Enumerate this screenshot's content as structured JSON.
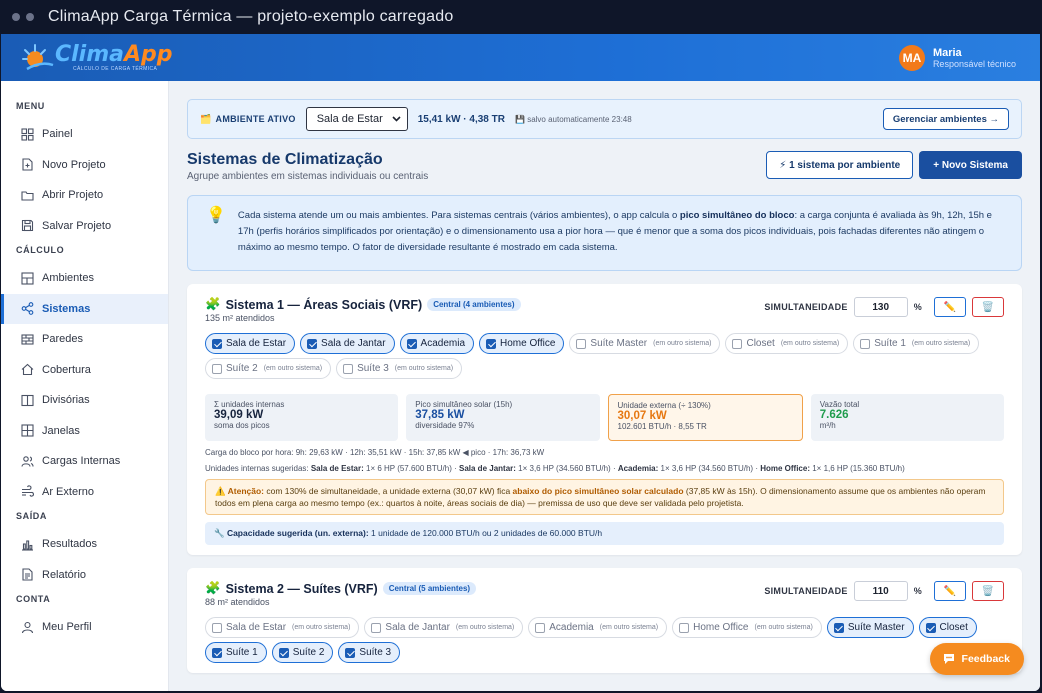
{
  "window": {
    "title": "ClimaApp Carga Térmica — projeto-exemplo carregado"
  },
  "brand": {
    "name_a": "Clima",
    "name_b": "App",
    "tagline": "CÁLCULO DE CARGA TÉRMICA",
    "colors": {
      "blue": "#1e6fd6",
      "orange": "#f58b1f"
    }
  },
  "user": {
    "initials": "MA",
    "name": "Maria",
    "role": "Responsável técnico"
  },
  "sidebar": {
    "sections": [
      {
        "label": "MENU",
        "items": [
          {
            "label": "Painel",
            "icon": "grid-icon"
          },
          {
            "label": "Novo Projeto",
            "icon": "file-plus-icon"
          },
          {
            "label": "Abrir Projeto",
            "icon": "folder-icon"
          },
          {
            "label": "Salvar Projeto",
            "icon": "save-icon"
          }
        ]
      },
      {
        "label": "CÁLCULO",
        "items": [
          {
            "label": "Ambientes",
            "icon": "layout-icon"
          },
          {
            "label": "Sistemas",
            "icon": "share-icon",
            "active": true
          },
          {
            "label": "Paredes",
            "icon": "brick-icon"
          },
          {
            "label": "Cobertura",
            "icon": "home-icon"
          },
          {
            "label": "Divisórias",
            "icon": "columns-icon"
          },
          {
            "label": "Janelas",
            "icon": "window-icon"
          },
          {
            "label": "Cargas Internas",
            "icon": "users-icon"
          },
          {
            "label": "Ar Externo",
            "icon": "wind-icon"
          }
        ]
      },
      {
        "label": "SAÍDA",
        "items": [
          {
            "label": "Resultados",
            "icon": "bar-chart-icon"
          },
          {
            "label": "Relatório",
            "icon": "document-icon"
          }
        ]
      },
      {
        "label": "CONTA",
        "items": [
          {
            "label": "Meu Perfil",
            "icon": "user-icon"
          }
        ]
      }
    ]
  },
  "active_env": {
    "label": "AMBIENTE ATIVO",
    "selected": "Sala de Estar",
    "value": "15,41 kW · 4,38 TR",
    "saved": "salvo automaticamente 23:48",
    "manage_button": "Gerenciar ambientes →"
  },
  "page": {
    "title": "Sistemas de Climatização",
    "subtitle": "Agrupe ambientes em sistemas individuais ou centrais",
    "btn_one_per_env": "⚡ 1 sistema por ambiente",
    "btn_new": "+ Novo Sistema"
  },
  "info": {
    "t1": "Cada sistema atende um ou mais ambientes. Para sistemas centrais (vários ambientes), o app calcula o ",
    "b1": "pico simultâneo do bloco",
    "t2": ": a carga conjunta é avaliada às 9h, 12h, 15h e 17h (perfis horários simplificados por orientação) e o dimensionamento usa a pior hora — que é menor que a soma dos picos individuais, pois fachadas diferentes não atingem o máximo ao mesmo tempo. O fator de diversidade resultante é mostrado em cada sistema."
  },
  "simul_label": "SIMULTANEIDADE",
  "pct": "%",
  "systems": [
    {
      "title": "Sistema 1 — Áreas Sociais (VRF)",
      "pill": "Central (4 ambientes)",
      "area": "135 m² atendidos",
      "simul": "130",
      "chips": [
        {
          "label": "Sala de Estar",
          "on": true,
          "note": ""
        },
        {
          "label": "Sala de Jantar",
          "on": true,
          "note": ""
        },
        {
          "label": "Academia",
          "on": true,
          "note": ""
        },
        {
          "label": "Home Office",
          "on": true,
          "note": ""
        },
        {
          "label": "Suíte Master",
          "on": false,
          "note": "(em outro sistema)"
        },
        {
          "label": "Closet",
          "on": false,
          "note": "(em outro sistema)"
        },
        {
          "label": "Suíte 1",
          "on": false,
          "note": "(em outro sistema)"
        },
        {
          "label": "Suíte 2",
          "on": false,
          "note": "(em outro sistema)"
        },
        {
          "label": "Suíte 3",
          "on": false,
          "note": "(em outro sistema)"
        }
      ],
      "stats": [
        {
          "label": "Σ unidades internas",
          "value": "39,09 kW",
          "sub": "soma dos picos",
          "style": ""
        },
        {
          "label": "Pico simultâneo solar (15h)",
          "value": "37,85 kW",
          "sub": "diversidade 97%",
          "style": "blue"
        },
        {
          "label": "Unidade externa (÷ 130%)",
          "value": "30,07 kW",
          "sub": "102.601 BTU/h · 8,55 TR",
          "style": "orange"
        },
        {
          "label": "Vazão total",
          "value": "7.626",
          "sub": "m³/h",
          "style": "green"
        }
      ],
      "hourly": "Carga do bloco por hora: 9h: 29,63 kW · 12h: 35,51 kW · 15h: 37,85 kW ◀ pico · 17h: 36,73 kW",
      "units_label": "Unidades internas sugeridas: ",
      "units": [
        {
          "env": "Sala de Estar:",
          "txt": " 1× 6 HP (57.600 BTU/h) · "
        },
        {
          "env": "Sala de Jantar:",
          "txt": " 1× 3,6 HP (34.560 BTU/h) · "
        },
        {
          "env": "Academia:",
          "txt": " 1× 3,6 HP (34.560 BTU/h) · "
        },
        {
          "env": "Home Office:",
          "txt": " 1× 1,6 HP (15.360 BTU/h)"
        }
      ],
      "warn": {
        "b1": "⚠️ Atenção:",
        "t1": " com 130% de simultaneidade, a unidade externa (30,07 kW) fica ",
        "b2": "abaixo do pico simultâneo solar calculado",
        "t2": " (37,85 kW às 15h). O dimensionamento assume que os ambientes não operam todos em plena carga ao mesmo tempo (ex.: quartos à noite, áreas sociais de dia) — premissa de uso que deve ser validada pelo projetista."
      },
      "cap": {
        "b": "🔧 Capacidade sugerida (un. externa):",
        "t": " 1 unidade de 120.000 BTU/h ou 2 unidades de 60.000 BTU/h"
      }
    },
    {
      "title": "Sistema 2 — Suítes (VRF)",
      "pill": "Central (5 ambientes)",
      "area": "88 m² atendidos",
      "simul": "110",
      "chips": [
        {
          "label": "Sala de Estar",
          "on": false,
          "note": "(em outro sistema)"
        },
        {
          "label": "Sala de Jantar",
          "on": false,
          "note": "(em outro sistema)"
        },
        {
          "label": "Academia",
          "on": false,
          "note": "(em outro sistema)"
        },
        {
          "label": "Home Office",
          "on": false,
          "note": "(em outro sistema)"
        },
        {
          "label": "Suíte Master",
          "on": true,
          "note": ""
        },
        {
          "label": "Closet",
          "on": true,
          "note": ""
        },
        {
          "label": "Suíte 1",
          "on": true,
          "note": ""
        },
        {
          "label": "Suíte 2",
          "on": true,
          "note": ""
        },
        {
          "label": "Suíte 3",
          "on": true,
          "note": ""
        }
      ]
    }
  ],
  "feedback": "Feedback"
}
